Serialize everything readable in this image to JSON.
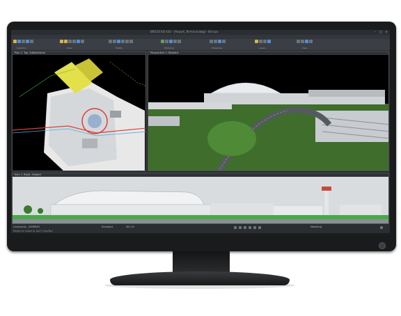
{
  "app": {
    "window_title": "BRICSCAD V20 - [Airport_Terminal.dwg] - Bricsys",
    "window_buttons": [
      "–",
      "□",
      "×"
    ]
  },
  "menu": {
    "logo": "B",
    "items": [
      "File",
      "Edit",
      "View",
      "Insert",
      "Format",
      "Tools",
      "Draw",
      "Dimension",
      "Modify",
      "Parametric",
      "BIM",
      "Help"
    ]
  },
  "ribbon": {
    "group_labels": [
      "Selection",
      "Draw",
      "Modify",
      "Modeling",
      "Properties",
      "Layers",
      "View"
    ]
  },
  "viewports": {
    "plan": {
      "title": "Plan 1: Top, 2dWireframe"
    },
    "perspective": {
      "title": "Perspective 1: Realistic"
    },
    "elevation": {
      "title": "Elev 1: Right, Shaded"
    }
  },
  "statusbar": {
    "command_line": "Command: _VIEWRES",
    "command_hint": "Regen on zoom or pan? [Yes/No]",
    "fields": [
      "Standard",
      "ISO-25",
      "Modeling"
    ],
    "colors": {
      "bg": "#2a2d31",
      "text": "#b9bdc1"
    }
  },
  "icons": [
    "windows-minimize-icon",
    "windows-maximize-icon",
    "windows-close-icon",
    "select-icon",
    "line-icon",
    "circle-icon",
    "layer-icon",
    "settings-icon"
  ]
}
